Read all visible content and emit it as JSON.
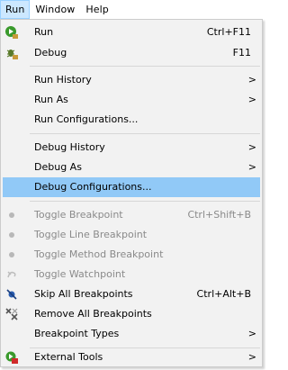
{
  "menubar": [
    {
      "label": "Run",
      "active": true
    },
    {
      "label": "Window",
      "active": false
    },
    {
      "label": "Help",
      "active": false
    }
  ],
  "menu": {
    "run": {
      "label": "Run",
      "shortcut": "Ctrl+F11"
    },
    "debug": {
      "label": "Debug",
      "shortcut": "F11"
    },
    "run_history": {
      "label": "Run History",
      "arrow": ">"
    },
    "run_as": {
      "label": "Run As",
      "arrow": ">"
    },
    "run_configurations": {
      "label": "Run Configurations..."
    },
    "debug_history": {
      "label": "Debug History",
      "arrow": ">"
    },
    "debug_as": {
      "label": "Debug As",
      "arrow": ">"
    },
    "debug_configurations": {
      "label": "Debug Configurations..."
    },
    "toggle_breakpoint": {
      "label": "Toggle Breakpoint",
      "shortcut": "Ctrl+Shift+B"
    },
    "toggle_line_breakpoint": {
      "label": "Toggle Line Breakpoint"
    },
    "toggle_method_breakpoint": {
      "label": "Toggle Method Breakpoint"
    },
    "toggle_watchpoint": {
      "label": "Toggle Watchpoint"
    },
    "skip_all_breakpoints": {
      "label": "Skip All Breakpoints",
      "shortcut": "Ctrl+Alt+B"
    },
    "remove_all_breakpoints": {
      "label": "Remove All Breakpoints"
    },
    "breakpoint_types": {
      "label": "Breakpoint Types",
      "arrow": ">"
    },
    "external_tools": {
      "label": "External Tools",
      "arrow": ">"
    }
  },
  "colors": {
    "menu_bg": "#f2f2f2",
    "highlight": "#91c9f7",
    "menubar_active": "#cce8ff",
    "disabled_text": "#8a8a8a"
  }
}
